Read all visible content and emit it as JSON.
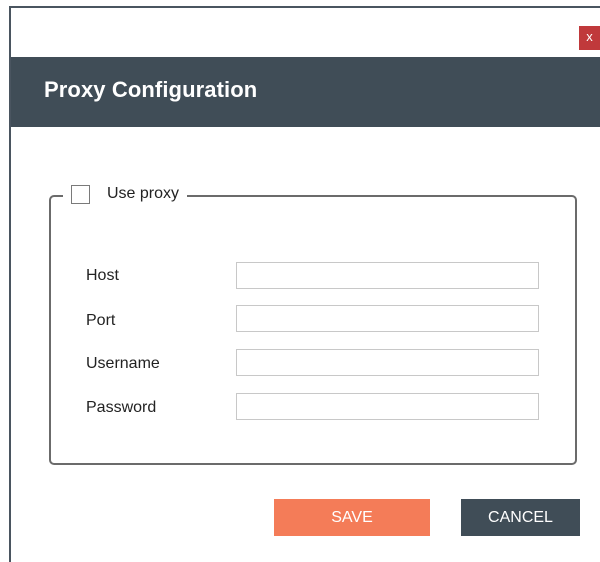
{
  "window": {
    "close_label": "x",
    "title": "Proxy Configuration"
  },
  "proxy": {
    "use_proxy_label": "Use proxy",
    "use_proxy_checked": false,
    "fields": {
      "host": {
        "label": "Host",
        "value": ""
      },
      "port": {
        "label": "Port",
        "value": ""
      },
      "username": {
        "label": "Username",
        "value": ""
      },
      "password": {
        "label": "Password",
        "value": ""
      }
    }
  },
  "actions": {
    "save_label": "SAVE",
    "cancel_label": "CANCEL"
  },
  "colors": {
    "header_bg": "#404d57",
    "save_bg": "#f47c58",
    "cancel_bg": "#404d57",
    "close_bg": "#c0393b"
  }
}
